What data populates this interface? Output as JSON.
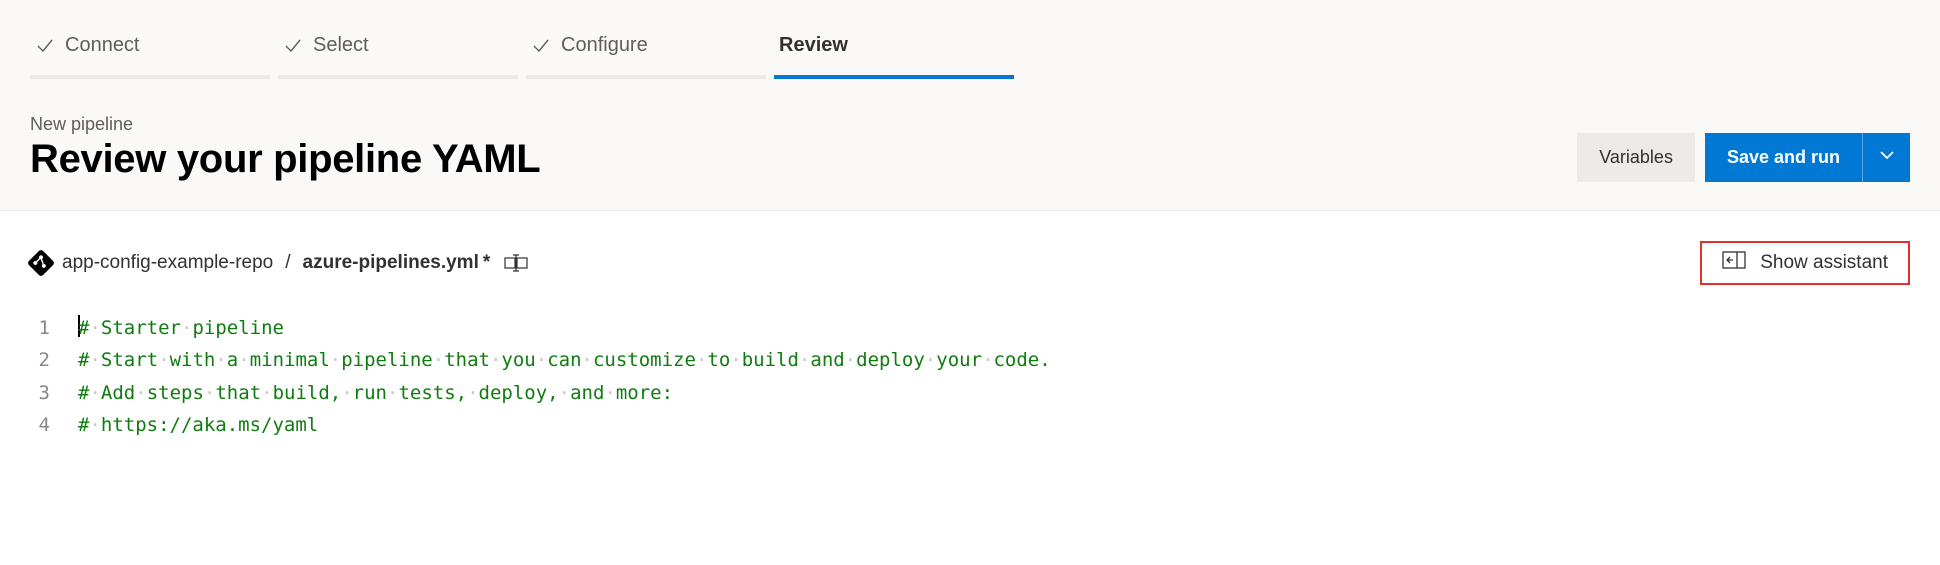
{
  "stepper": [
    {
      "label": "Connect",
      "done": true,
      "current": false
    },
    {
      "label": "Select",
      "done": true,
      "current": false
    },
    {
      "label": "Configure",
      "done": true,
      "current": false
    },
    {
      "label": "Review",
      "done": false,
      "current": true
    }
  ],
  "header": {
    "subtitle": "New pipeline",
    "title": "Review your pipeline YAML",
    "variables_label": "Variables",
    "save_run_label": "Save and run"
  },
  "breadcrumb": {
    "repo": "app-config-example-repo",
    "separator": "/",
    "filename": "azure-pipelines.yml",
    "dirty": "*"
  },
  "assistant": {
    "label": "Show assistant"
  },
  "editor": {
    "lines": [
      {
        "num": "1",
        "text": "# Starter pipeline"
      },
      {
        "num": "2",
        "text": "# Start with a minimal pipeline that you can customize to build and deploy your code."
      },
      {
        "num": "3",
        "text": "# Add steps that build, run tests, deploy, and more:"
      },
      {
        "num": "4",
        "text": "# https://aka.ms/yaml"
      }
    ]
  }
}
